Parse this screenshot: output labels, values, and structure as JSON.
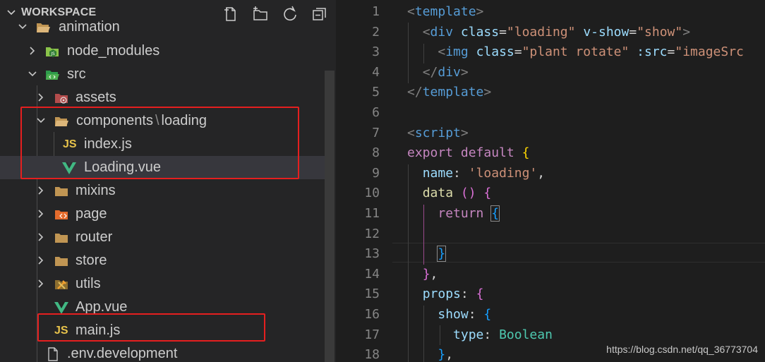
{
  "sidebar": {
    "header": {
      "title": "WORKSPACE"
    },
    "header_actions": [
      {
        "name": "new-file-button",
        "icon": "new-file-icon"
      },
      {
        "name": "new-folder-button",
        "icon": "new-folder-icon"
      },
      {
        "name": "refresh-button",
        "icon": "refresh-icon"
      },
      {
        "name": "collapse-all-button",
        "icon": "collapse-all-icon"
      }
    ],
    "tree": [
      {
        "label": "animation",
        "type": "folder",
        "expanded": true
      },
      {
        "label": "node_modules",
        "type": "folder",
        "icon": "node-folder-icon"
      },
      {
        "label": "src",
        "type": "folder",
        "expanded": true,
        "icon": "src-folder-icon"
      },
      {
        "label": "assets",
        "type": "folder",
        "icon": "assets-folder-icon"
      },
      {
        "label": "components",
        "label2": "loading",
        "type": "folder",
        "expanded": true
      },
      {
        "label": "index.js",
        "type": "file",
        "badge": "JS"
      },
      {
        "label": "Loading.vue",
        "type": "file",
        "icon": "vue-icon",
        "selected": true
      },
      {
        "label": "mixins",
        "type": "folder"
      },
      {
        "label": "page",
        "type": "folder",
        "icon": "page-folder-icon"
      },
      {
        "label": "router",
        "type": "folder"
      },
      {
        "label": "store",
        "type": "folder"
      },
      {
        "label": "utils",
        "type": "folder",
        "icon": "utils-folder-icon"
      },
      {
        "label": "App.vue",
        "type": "file",
        "icon": "vue-icon"
      },
      {
        "label": "main.js",
        "type": "file",
        "badge": "JS"
      },
      {
        "label": ".env.development",
        "type": "file",
        "icon": "file-icon"
      }
    ]
  },
  "editor": {
    "lines": [
      {
        "n": "1"
      },
      {
        "n": "2"
      },
      {
        "n": "3"
      },
      {
        "n": "4"
      },
      {
        "n": "5"
      },
      {
        "n": "6"
      },
      {
        "n": "7"
      },
      {
        "n": "8"
      },
      {
        "n": "9"
      },
      {
        "n": "10"
      },
      {
        "n": "11"
      },
      {
        "n": "12"
      },
      {
        "n": "13"
      },
      {
        "n": "14"
      },
      {
        "n": "15"
      },
      {
        "n": "16"
      },
      {
        "n": "17"
      },
      {
        "n": "18"
      }
    ],
    "code": {
      "l1": "template",
      "l2_tag": "div",
      "l2_a1": "class",
      "l2_v1": "\"loading\"",
      "l2_a2": "v-show",
      "l2_v2": "\"show\"",
      "l3_tag": "img",
      "l3_a1": "class",
      "l3_v1": "\"plant rotate\"",
      "l3_a2": ":src",
      "l3_v2": "\"imageSrc",
      "l4_tag": "div",
      "l5_tag": "template",
      "l7_tag": "script",
      "l8_kw1": "export",
      "l8_kw2": "default",
      "l9_prop": "name",
      "l9_val": "'loading'",
      "l10_fn": "data",
      "l11_kw": "return",
      "l15_prop": "props",
      "l16_prop": "show",
      "l17_prop": "type",
      "l17_val": "Boolean"
    }
  },
  "watermark": "https://blog.csdn.net/qq_36773704",
  "colors": {
    "highlight_box": "#e51f1f",
    "js_badge": "#e8c34b",
    "vue": "#41b883"
  }
}
